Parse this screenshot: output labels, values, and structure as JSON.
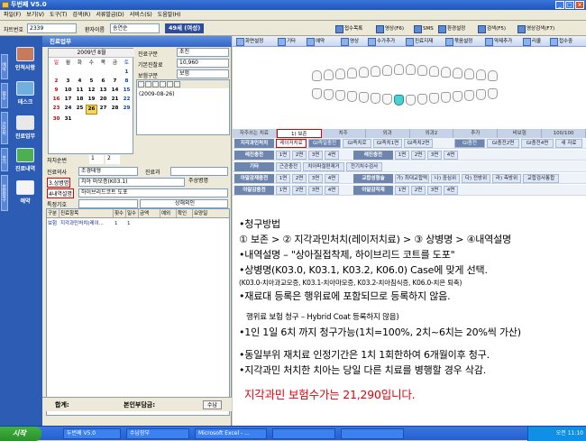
{
  "window": {
    "title": "두번째 V5.0",
    "controls": [
      "_",
      "□",
      "×"
    ]
  },
  "menu": [
    "파일(F)",
    "보기(V)",
    "도구(T)",
    "검색(R)",
    "서류발급(D)",
    "서비스(S)",
    "도움말(H)"
  ],
  "patientbar": {
    "chart_label": "차트번호",
    "chart_value": "2339",
    "name_label": "환자이름",
    "name_value": "송연순",
    "age_badge": "49세 (여성)",
    "buttons": [
      "접수목록",
      "영상(F6)",
      "SMS",
      "환경설정",
      "검색(F5)",
      "영상검색(F7)"
    ]
  },
  "sidebar": {
    "tabs": [
      "예약",
      "접수",
      "간단히",
      "보기",
      "보험청구"
    ],
    "items": [
      "인적사항",
      "테스크",
      "진료업무",
      "진료내역",
      "예약"
    ]
  },
  "left": {
    "header": "진료업무",
    "calendar": {
      "title": "2009년 8월",
      "weekdays": [
        "일",
        "월",
        "화",
        "수",
        "목",
        "금",
        "토"
      ],
      "days": [
        "",
        "",
        "",
        "",
        "",
        "",
        "1",
        "2",
        "3",
        "4",
        "5",
        "6",
        "7",
        "8",
        "9",
        "10",
        "11",
        "12",
        "13",
        "14",
        "15",
        "16",
        "17",
        "18",
        "19",
        "20",
        "21",
        "22",
        "23",
        "24",
        "25",
        "26",
        "27",
        "28",
        "29",
        "30",
        "31"
      ],
      "selected": "26"
    },
    "info": [
      {
        "label": "진료구분",
        "value": "초진"
      },
      {
        "label": "기본진찰료",
        "value": "10,960"
      },
      {
        "label": "보험구분",
        "value": "보험"
      }
    ],
    "visit_date": "(2009-08-26)",
    "chair_label": "처치순번",
    "chair_values": [
      "1",
      "2"
    ],
    "form": [
      {
        "label": "진료의사",
        "value": "조경태형",
        "label2": "진료과",
        "value2": ""
      },
      {
        "label": "3.상병명",
        "value": "치아 마모증(K03.1)",
        "extra": "주상병명"
      },
      {
        "label": "4내역설명",
        "value": "하이브리드코트 도포",
        "extra": ""
      },
      {
        "label": "특정기호",
        "value": "",
        "extra": "상해외인"
      }
    ],
    "table": {
      "headers": [
        "구분",
        "진료항목",
        "횟수",
        "일수",
        "금액",
        "예외",
        "확인",
        "요양일"
      ],
      "row": [
        "보험",
        "지각과민처치(레이...",
        "1",
        "1",
        "",
        "",
        "",
        ""
      ]
    },
    "footer": {
      "total_label": "합계:",
      "self_label": "본인부담금:",
      "button": "수납"
    }
  },
  "right": {
    "toolbar": [
      "화면설정",
      "기타",
      "예약",
      "영상",
      "수가추가",
      "진료지재",
      "묶음설정",
      "약제추가",
      "리콜",
      "접수중"
    ],
    "tabs": [
      "자주쓰는 치료",
      "1) 보존",
      "치주",
      "외과",
      "외과2",
      "추가",
      "비보험",
      "100/100"
    ],
    "rows": [
      {
        "label": "지각과민처치",
        "chips": [
          "레이저치료",
          "GI즉일충전",
          "GI즉치로",
          "GI즉치1면",
          "GI즉치2면",
          "GI충전",
          "GI충전2면",
          "GI충전4면",
          "새 자료"
        ]
      },
      {
        "label": "레진충전",
        "chips": [
          "1면",
          "2면",
          "3면",
          "4면",
          "레진충전",
          "1면",
          "2면",
          "3면",
          "4면"
        ]
      },
      {
        "label": "기타",
        "chips": [
          "근관충전",
          "치아파절편제거",
          "전기치수검사"
        ]
      },
      {
        "label": "아말감재충전",
        "chips": [
          "1면",
          "2면",
          "3면",
          "4면",
          "교합성형술",
          "가) 최대교합력",
          "나) 중심위",
          "다) 전방위",
          "라) 측방위",
          "교합검사통합"
        ]
      },
      {
        "label": "아말감충전",
        "chips": [
          "1면",
          "2면",
          "3면",
          "4면",
          "아말감직재",
          "1면",
          "2면",
          "3면",
          "4면"
        ]
      }
    ]
  },
  "notes": {
    "l1": "•청구방법",
    "l2": "① 보존 > ② 지각과민처치(레이저치료) > ③ 상병명 > ④내역설명",
    "l3": "•내역설명 – \"상아질접착제, 하이브리드 코트를 도포\"",
    "l4": "•상병명(K03.0, K03.1, K03.2, K06.0) Case에 맞게 선택.",
    "l5": "(K03.0-치아과교모증, K03.1-치아마모증, K03.2-치아침식증, K06.0-치은 퇴축)",
    "l6": "•재료대 등록은 행위료에 포함되므로 등록하지 않음.",
    "l7": "행위료 보험 청구 – Hybrid Coat 등록하지 않음)",
    "l8": "•1인 1일 6치 까지 청구가능(1치=100%, 2치~6치는 20%씩 가산)",
    "l9": "•동일부위 재치료 인정기간은 1치 1회한하여 6개월이후 청구.",
    "l10": "•지각과민 처치한 치아는 당일 다른 치료를 병행할 경우 삭감.",
    "l11": "지각과민 보험수가는 21,290입니다."
  },
  "taskbar": {
    "start": "시작",
    "items": [
      "두번째 V5.0",
      "수납장부",
      "Microsoft Excel - ...",
      "",
      ""
    ],
    "time": "오전 11:10"
  },
  "colors": {
    "accent_red": "#e2000a",
    "title_blue": "#2c5fcc",
    "sidebar_blue": "#2d5cb4"
  }
}
